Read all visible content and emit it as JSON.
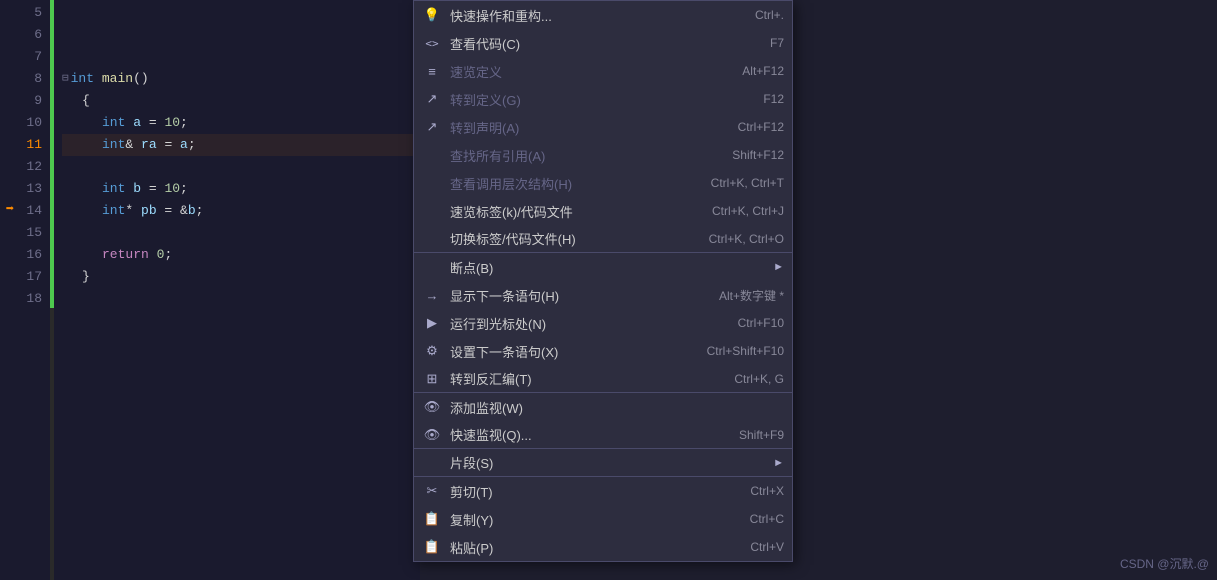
{
  "editor": {
    "lines": [
      {
        "num": "5",
        "code": "",
        "type": "plain"
      },
      {
        "num": "6",
        "code": "",
        "type": "plain"
      },
      {
        "num": "7",
        "code": "",
        "type": "plain"
      },
      {
        "num": "8",
        "code": "int main()",
        "type": "func"
      },
      {
        "num": "9",
        "code": "{",
        "type": "plain"
      },
      {
        "num": "10",
        "code": "    int a = 10;",
        "type": "code"
      },
      {
        "num": "11",
        "code": "    int& ra = a;",
        "type": "code_active"
      },
      {
        "num": "12",
        "code": "",
        "type": "plain"
      },
      {
        "num": "13",
        "code": "    int b = 10;",
        "type": "code"
      },
      {
        "num": "14",
        "code": "    int* pb = &b;",
        "type": "code"
      },
      {
        "num": "15",
        "code": "",
        "type": "plain"
      },
      {
        "num": "16",
        "code": "    return 0;",
        "type": "code"
      },
      {
        "num": "17",
        "code": "}",
        "type": "plain"
      },
      {
        "num": "18",
        "code": "",
        "type": "plain"
      }
    ]
  },
  "context_menu": {
    "items": [
      {
        "id": "quick-action",
        "icon": "💡",
        "label": "快速操作和重构...",
        "shortcut": "Ctrl+.",
        "disabled": false,
        "has_sub": false,
        "sep_after": false
      },
      {
        "id": "view-code",
        "icon": "<>",
        "label": "查看代码(C)",
        "shortcut": "F7",
        "disabled": false,
        "has_sub": false,
        "sep_after": false
      },
      {
        "id": "quick-def",
        "icon": "≡",
        "label": "速览定义",
        "shortcut": "Alt+F12",
        "disabled": true,
        "has_sub": false,
        "sep_after": false
      },
      {
        "id": "goto-def",
        "icon": "↗",
        "label": "转到定义(G)",
        "shortcut": "F12",
        "disabled": true,
        "has_sub": false,
        "sep_after": false
      },
      {
        "id": "goto-decl",
        "icon": "↗",
        "label": "转到声明(A)",
        "shortcut": "Ctrl+F12",
        "disabled": true,
        "has_sub": false,
        "sep_after": false
      },
      {
        "id": "find-refs",
        "icon": "",
        "label": "查找所有引用(A)",
        "shortcut": "Shift+F12",
        "disabled": true,
        "has_sub": false,
        "sep_after": false
      },
      {
        "id": "call-hierarchy",
        "icon": "",
        "label": "查看调用层次结构(H)",
        "shortcut": "Ctrl+K, Ctrl+T",
        "disabled": true,
        "has_sub": false,
        "sep_after": false
      },
      {
        "id": "browse-tags",
        "icon": "",
        "label": "速览标签(k)/代码文件",
        "shortcut": "Ctrl+K, Ctrl+J",
        "disabled": false,
        "has_sub": false,
        "sep_after": false
      },
      {
        "id": "toggle-tags",
        "icon": "",
        "label": "切换标签/代码文件(H)",
        "shortcut": "Ctrl+K, Ctrl+O",
        "disabled": false,
        "has_sub": false,
        "sep_after": true
      },
      {
        "id": "breakpoint",
        "icon": "",
        "label": "断点(B)",
        "shortcut": "",
        "disabled": false,
        "has_sub": true,
        "sep_after": false
      },
      {
        "id": "show-next",
        "icon": "→",
        "label": "显示下一条语句(H)",
        "shortcut": "Alt+数字键 *",
        "disabled": false,
        "has_sub": false,
        "sep_after": false
      },
      {
        "id": "run-to-cursor",
        "icon": "▶",
        "label": "运行到光标处(N)",
        "shortcut": "Ctrl+F10",
        "disabled": false,
        "has_sub": false,
        "sep_after": false
      },
      {
        "id": "set-next",
        "icon": "⚙",
        "label": "设置下一条语句(X)",
        "shortcut": "Ctrl+Shift+F10",
        "disabled": false,
        "has_sub": false,
        "sep_after": false
      },
      {
        "id": "goto-disasm",
        "icon": "⊞",
        "label": "转到反汇编(T)",
        "shortcut": "Ctrl+K, G",
        "disabled": false,
        "has_sub": false,
        "sep_after": true
      },
      {
        "id": "add-watch",
        "icon": "👁",
        "label": "添加监视(W)",
        "shortcut": "",
        "disabled": false,
        "has_sub": false,
        "sep_after": false
      },
      {
        "id": "quick-watch",
        "icon": "👁",
        "label": "快速监视(Q)...",
        "shortcut": "Shift+F9",
        "disabled": false,
        "has_sub": false,
        "sep_after": true
      },
      {
        "id": "snippet",
        "icon": "",
        "label": "片段(S)",
        "shortcut": "",
        "disabled": false,
        "has_sub": true,
        "sep_after": true
      },
      {
        "id": "cut",
        "icon": "✂",
        "label": "剪切(T)",
        "shortcut": "Ctrl+X",
        "disabled": false,
        "has_sub": false,
        "sep_after": false
      },
      {
        "id": "copy",
        "icon": "📋",
        "label": "复制(Y)",
        "shortcut": "Ctrl+C",
        "disabled": false,
        "has_sub": false,
        "sep_after": false
      },
      {
        "id": "paste",
        "icon": "📋",
        "label": "粘贴(P)",
        "shortcut": "Ctrl+V",
        "disabled": false,
        "has_sub": false,
        "sep_after": false
      }
    ]
  },
  "watermark": {
    "text": "CSDN @沉默.@"
  }
}
